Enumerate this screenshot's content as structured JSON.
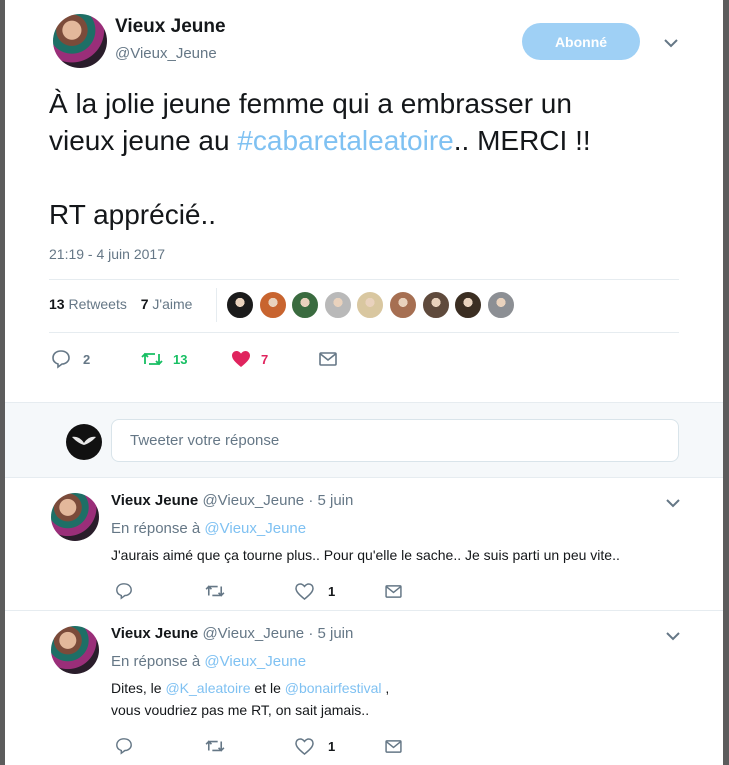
{
  "tweet": {
    "author_name": "Vieux Jeune",
    "author_handle": "@Vieux_Jeune",
    "follow_label": "Abonné",
    "text_before": "À la jolie jeune femme qui a embrasser un\nvieux jeune au ",
    "hashtag": "#cabaretaleatoire",
    "text_after": ".. MERCI !!\n\nRT apprécié..",
    "timestamp": "21:19 - 4 juin 2017",
    "retweets_count": "13",
    "retweets_label": "Retweets",
    "likes_count": "7",
    "likes_label": "J'aime",
    "actions": {
      "reply_count": "2",
      "retweet_count": "13",
      "like_count": "7"
    },
    "likers": [
      "#1b1b1b",
      "#c8642f",
      "#3a6b3f",
      "#b9b9b9",
      "#d9c7a0",
      "#a66f52",
      "#5f4a3c",
      "#3b2e22",
      "#8c8f94"
    ]
  },
  "reply_box": {
    "placeholder": "Tweeter votre réponse"
  },
  "replies": [
    {
      "name": "Vieux Jeune",
      "handle": "@Vieux_Jeune",
      "sep": "·",
      "date": "5 juin",
      "in_reply_prefix": "En réponse à",
      "in_reply_handle": "@Vieux_Jeune",
      "text": "J'aurais aimé que ça tourne plus.. Pour qu'elle le sache.. Je suis parti un peu vite..",
      "like_count": "1"
    },
    {
      "name": "Vieux Jeune",
      "handle": "@Vieux_Jeune",
      "sep": "·",
      "date": "5 juin",
      "in_reply_prefix": "En réponse à",
      "in_reply_handle": "@Vieux_Jeune",
      "text_1": "Dites, le ",
      "mention_1": "@K_aleatoire",
      "text_2": " et le ",
      "mention_2": "@bonairfestival",
      "text_3": " , vous voudriez pas me RT, on sait jamais..",
      "like_count": "1"
    }
  ],
  "colors": {
    "link": "#7fc1f2",
    "retweet": "#17bf63",
    "like": "#e0245e",
    "muted": "#657786"
  },
  "icons": [
    "reply-icon",
    "retweet-icon",
    "heart-icon",
    "message-icon",
    "chevron-down-icon"
  ]
}
